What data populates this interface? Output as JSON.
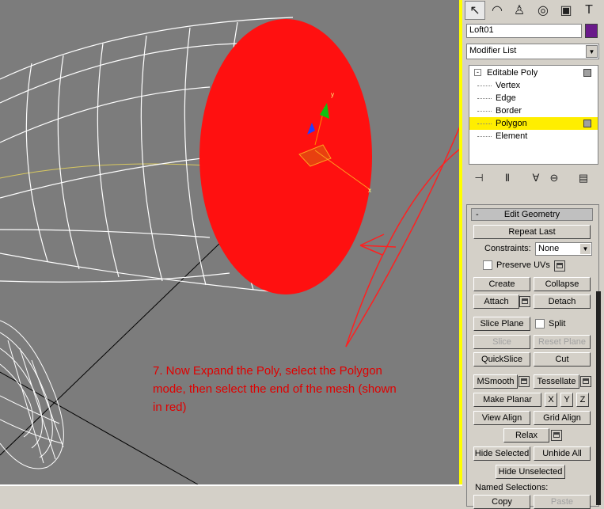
{
  "app": {
    "accent_selection": "#ffee00",
    "viewport_bg": "#7c7c7c"
  },
  "command_panel": {
    "tabs": [
      "create-icon",
      "modify-icon",
      "hierarchy-icon",
      "motion-icon",
      "display-icon",
      "utilities-icon"
    ],
    "object_name": "Loft01",
    "object_color": "#6a1a8a",
    "modifier_list": "Modifier List",
    "stack": {
      "root": "Editable Poly",
      "subobjects": [
        "Vertex",
        "Edge",
        "Border",
        "Polygon",
        "Element"
      ],
      "selected": "Polygon"
    },
    "stack_tools": [
      "pin-stack-icon",
      "show-end-result-icon",
      "make-unique-icon",
      "remove-modifier-icon",
      "configure-modifier-sets-icon"
    ]
  },
  "edit_geometry": {
    "title": "Edit Geometry",
    "collapse_sign": "-",
    "repeat_last": "Repeat Last",
    "constraints_label": "Constraints:",
    "constraints_value": "None",
    "preserve_uvs": "Preserve UVs",
    "create": "Create",
    "collapse": "Collapse",
    "attach": "Attach",
    "detach": "Detach",
    "slice_plane": "Slice Plane",
    "split": "Split",
    "slice": "Slice",
    "reset_plane": "Reset Plane",
    "quickslice": "QuickSlice",
    "cut": "Cut",
    "msmooth": "MSmooth",
    "tessellate": "Tessellate",
    "make_planar": "Make Planar",
    "x": "X",
    "y": "Y",
    "z": "Z",
    "view_align": "View Align",
    "grid_align": "Grid Align",
    "relax": "Relax",
    "hide_selected": "Hide Selected",
    "unhide_all": "Unhide All",
    "hide_unselected": "Hide Unselected",
    "named_selections": "Named Selections:",
    "copy": "Copy",
    "paste": "Paste"
  },
  "viewport": {
    "annotation_lines": [
      "7. Now Expand the Poly, select the Polygon",
      "mode, then select the end of the mesh (shown",
      "in  red)"
    ],
    "annotation_color": "#e00000",
    "selected_face_color": "#ff1010"
  }
}
